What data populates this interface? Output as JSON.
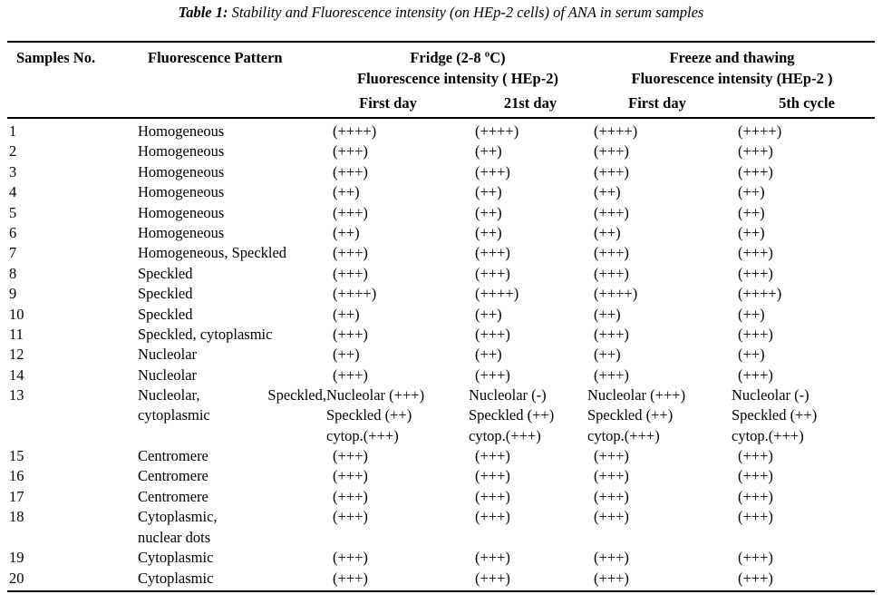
{
  "caption": {
    "label": "Table 1:",
    "text": " Stability and Fluorescence intensity (on HEp-2 cells) of ANA in serum samples"
  },
  "header": {
    "samples_no": "Samples No.",
    "fluorescence_pattern": "Fluorescence Pattern",
    "group_fridge_line1": "Fridge (2-8 ºC)",
    "group_fridge_line2": "Fluorescence intensity ( HEp-2)",
    "group_freeze_line1": "Freeze and thawing",
    "group_freeze_line2": "Fluorescence intensity (HEp-2 )",
    "sub_fridge_first_day": "First day",
    "sub_fridge_21st_day": "21st day",
    "sub_freeze_first_day": "First day",
    "sub_freeze_5th_cycle": "5th cycle"
  },
  "chart_data": {
    "type": "table",
    "title": "Table 1: Stability and Fluorescence intensity (on HEp-2 cells) of ANA in serum samples",
    "columns": [
      "Samples No.",
      "Fluorescence Pattern",
      "Fridge (2-8 ºC) Fluorescence intensity ( HEp-2) - First day",
      "Fridge (2-8 ºC) Fluorescence intensity ( HEp-2) - 21st day",
      "Freeze and thawing Fluorescence intensity (HEp-2 ) - First day",
      "Freeze and thawing Fluorescence intensity (HEp-2 ) - 5th cycle"
    ],
    "rows": [
      {
        "no": "1",
        "pattern": "Homogeneous",
        "fridge_first": "(++++)",
        "fridge_21": "(++++)",
        "freeze_first": "(++++)",
        "freeze_5th": "(++++)"
      },
      {
        "no": "2",
        "pattern": "Homogeneous",
        "fridge_first": "(+++)",
        "fridge_21": "(++)",
        "freeze_first": "(+++)",
        "freeze_5th": "(+++)"
      },
      {
        "no": "3",
        "pattern": "Homogeneous",
        "fridge_first": "(+++)",
        "fridge_21": "(+++)",
        "freeze_first": "(+++)",
        "freeze_5th": "(+++)"
      },
      {
        "no": "4",
        "pattern": "Homogeneous",
        "fridge_first": "(++)",
        "fridge_21": "(++)",
        "freeze_first": "(++)",
        "freeze_5th": "(++)"
      },
      {
        "no": "5",
        "pattern": "Homogeneous",
        "fridge_first": "(+++)",
        "fridge_21": "(++)",
        "freeze_first": "(+++)",
        "freeze_5th": "(++)"
      },
      {
        "no": "6",
        "pattern": "Homogeneous",
        "fridge_first": "(++)",
        "fridge_21": "(++)",
        "freeze_first": "(++)",
        "freeze_5th": "(++)"
      },
      {
        "no": "7",
        "pattern": "Homogeneous, Speckled",
        "fridge_first": "(+++)",
        "fridge_21": "(+++)",
        "freeze_first": "(+++)",
        "freeze_5th": "(+++)"
      },
      {
        "no": "8",
        "pattern": "Speckled",
        "fridge_first": "(+++)",
        "fridge_21": "(+++)",
        "freeze_first": "(+++)",
        "freeze_5th": "(+++)"
      },
      {
        "no": "9",
        "pattern": "Speckled",
        "fridge_first": "(++++)",
        "fridge_21": "(++++)",
        "freeze_first": "(++++)",
        "freeze_5th": "(++++)"
      },
      {
        "no": "10",
        "pattern": "Speckled",
        "fridge_first": "(++)",
        "fridge_21": "(++)",
        "freeze_first": "(++)",
        "freeze_5th": "(++)"
      },
      {
        "no": "11",
        "pattern": "Speckled, cytoplasmic",
        "fridge_first": "(+++)",
        "fridge_21": "(+++)",
        "freeze_first": "(+++)",
        "freeze_5th": "(+++)"
      },
      {
        "no": "12",
        "pattern": "Nucleolar",
        "fridge_first": "(++)",
        "fridge_21": "(++)",
        "freeze_first": "(++)",
        "freeze_5th": "(++)"
      },
      {
        "no": "14",
        "pattern": "Nucleolar",
        "fridge_first": "(+++)",
        "fridge_21": "(+++)",
        "freeze_first": "(+++)",
        "freeze_5th": "(+++)"
      },
      {
        "no": "13",
        "pattern_line1_a": "Nucleolar,",
        "pattern_line1_b": "Speckled,",
        "pattern_line2": "cytoplasmic",
        "fridge_first_l1": "Nucleolar (+++)",
        "fridge_first_l2": "Speckled (++)",
        "fridge_first_l3": "cytop.(+++)",
        "fridge_21_l1": "Nucleolar (-)",
        "fridge_21_l2": "Speckled (++)",
        "fridge_21_l3": "cytop.(+++)",
        "freeze_first_l1": "Nucleolar (+++)",
        "freeze_first_l2": "Speckled (++)",
        "freeze_first_l3": "cytop.(+++)",
        "freeze_5th_l1": "Nucleolar (-)",
        "freeze_5th_l2": "Speckled (++)",
        "freeze_5th_l3": "cytop.(+++)"
      },
      {
        "no": "15",
        "pattern": "Centromere",
        "fridge_first": "(+++)",
        "fridge_21": "(+++)",
        "freeze_first": "(+++)",
        "freeze_5th": "(+++)"
      },
      {
        "no": "16",
        "pattern": "Centromere",
        "fridge_first": "(+++)",
        "fridge_21": "(+++)",
        "freeze_first": "(+++)",
        "freeze_5th": "(+++)"
      },
      {
        "no": "17",
        "pattern": "Centromere",
        "fridge_first": "(+++)",
        "fridge_21": "(+++)",
        "freeze_first": "(+++)",
        "freeze_5th": "(+++)"
      },
      {
        "no": "18",
        "pattern_line1": "Cytoplasmic,",
        "pattern_line2": "nuclear dots",
        "fridge_first": "(+++)",
        "fridge_21": "(+++)",
        "freeze_first": "(+++)",
        "freeze_5th": "(+++)"
      },
      {
        "no": "19",
        "pattern": "Cytoplasmic",
        "fridge_first": "(+++)",
        "fridge_21": "(+++)",
        "freeze_first": "(+++)",
        "freeze_5th": "(+++)"
      },
      {
        "no": "20",
        "pattern": "Cytoplasmic",
        "fridge_first": "(+++)",
        "fridge_21": "(+++)",
        "freeze_first": "(+++)",
        "freeze_5th": "(+++)"
      }
    ]
  }
}
